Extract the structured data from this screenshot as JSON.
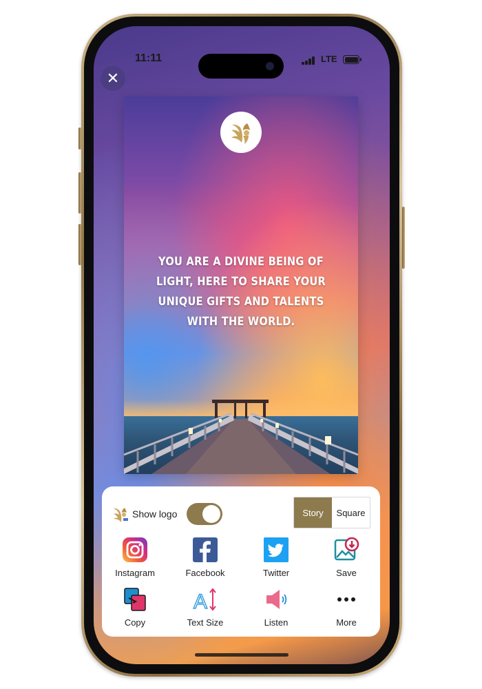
{
  "status": {
    "time": "11:11",
    "network": "LTE"
  },
  "card": {
    "quote": "YOU ARE A DIVINE BEING OF LIGHT, HERE TO SHARE YOUR UNIQUE GIFTS AND TALENTS WITH THE WORLD."
  },
  "sheet": {
    "show_logo_label": "Show logo",
    "show_logo_on": true,
    "format_options": [
      "Story",
      "Square"
    ],
    "format_selected": "Story",
    "actions": [
      {
        "label": "Instagram",
        "icon": "instagram-icon"
      },
      {
        "label": "Facebook",
        "icon": "facebook-icon"
      },
      {
        "label": "Twitter",
        "icon": "twitter-icon"
      },
      {
        "label": "Save",
        "icon": "save-image-icon"
      },
      {
        "label": "Copy",
        "icon": "copy-icon"
      },
      {
        "label": "Text Size",
        "icon": "text-size-icon"
      },
      {
        "label": "Listen",
        "icon": "speaker-icon"
      },
      {
        "label": "More",
        "icon": "more-dots-icon"
      }
    ]
  },
  "colors": {
    "accent": "#8d7b4e"
  }
}
